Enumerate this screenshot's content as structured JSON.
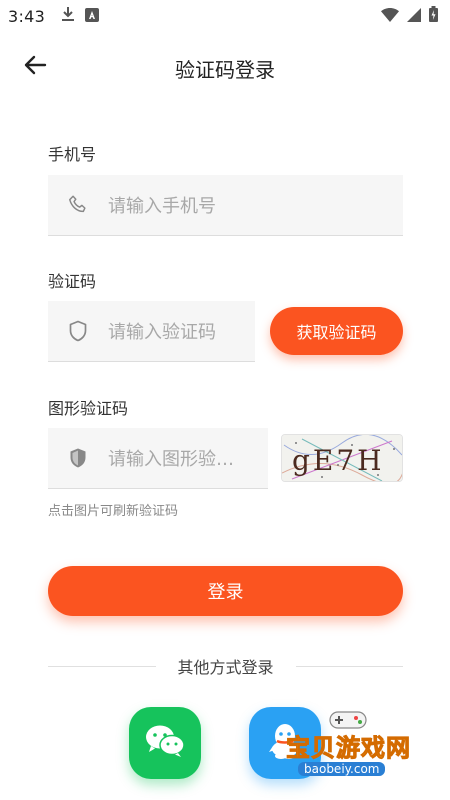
{
  "status_bar": {
    "time": "3:43"
  },
  "header": {
    "title": "验证码登录"
  },
  "phone": {
    "label": "手机号",
    "placeholder": "请输入手机号"
  },
  "sms_code": {
    "label": "验证码",
    "placeholder": "请输入验证码",
    "get_code_label": "获取验证码"
  },
  "image_code": {
    "label": "图形验证码",
    "placeholder": "请输入图形验…",
    "captcha_text": "gE7H",
    "refresh_hint": "点击图片可刷新验证码"
  },
  "login": {
    "label": "登录"
  },
  "other_login": {
    "divider_text": "其他方式登录"
  },
  "watermark": {
    "title": "宝贝游戏网",
    "site": "baobeiy.com"
  },
  "colors": {
    "accent": "#fb5420",
    "wechat": "#16c35c",
    "qq": "#2aa1f3",
    "input_bg": "#f6f6f6"
  }
}
